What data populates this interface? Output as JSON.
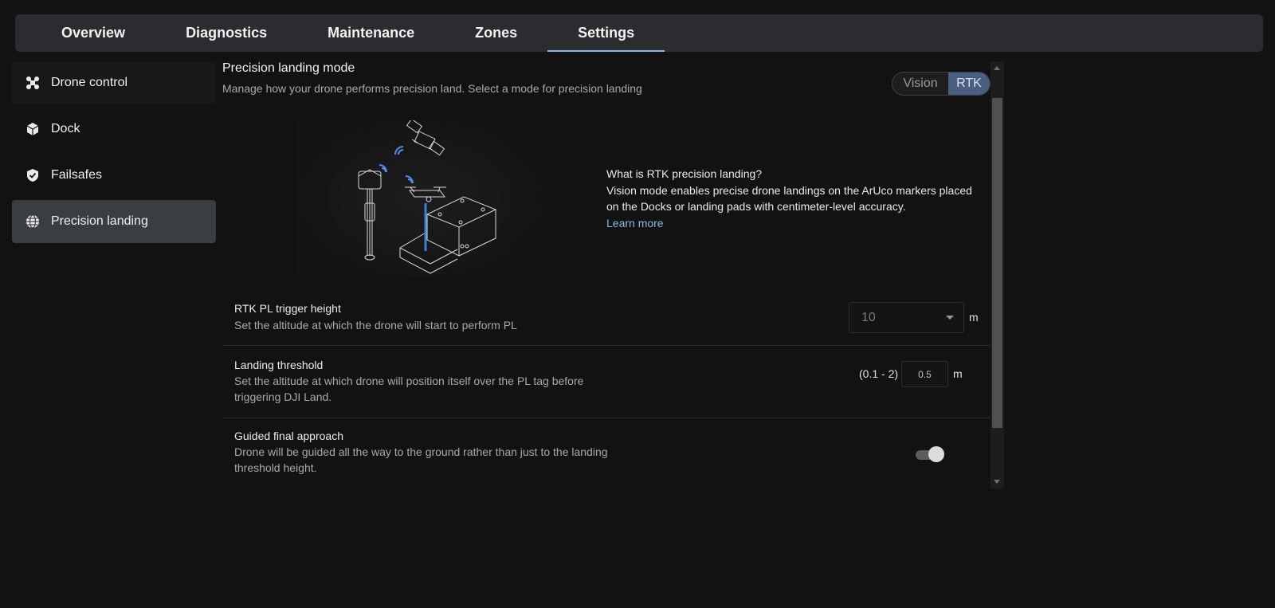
{
  "tabs": [
    {
      "label": "Overview"
    },
    {
      "label": "Diagnostics"
    },
    {
      "label": "Maintenance"
    },
    {
      "label": "Zones"
    },
    {
      "label": "Settings",
      "active": true
    }
  ],
  "sidebar": {
    "items": [
      {
        "label": "Drone control",
        "icon": "drone-icon"
      },
      {
        "label": "Dock",
        "icon": "cube-icon"
      },
      {
        "label": "Failsafes",
        "icon": "shield-check-icon"
      },
      {
        "label": "Precision landing",
        "icon": "globe-icon",
        "active": true
      }
    ]
  },
  "panel": {
    "title": "Precision landing mode",
    "description": "Manage how your drone performs precision land. Select a mode for precision landing",
    "mode_options": [
      "Vision",
      "RTK"
    ],
    "mode_selected": "RTK"
  },
  "info": {
    "heading": "What is RTK precision landing?",
    "body": "Vision mode enables precise drone landings on the ArUco markers placed on the Docks or landing pads with centimeter-level accuracy.",
    "link": "Learn more"
  },
  "settings": {
    "trigger_height": {
      "title": "RTK PL trigger height",
      "description": "Set the altitude at which the drone will start to perform PL",
      "value": "10",
      "unit": "m"
    },
    "landing_threshold": {
      "title": "Landing threshold",
      "description": "Set the altitude at which drone will position itself over the PL tag before triggering DJI Land.",
      "range": "(0.1 - 2)",
      "value": "0.5",
      "unit": "m"
    },
    "guided_approach": {
      "title": "Guided final approach",
      "description": "Drone will be guided all the way to the ground rather than just to the landing threshold height.",
      "enabled": true
    }
  },
  "colors": {
    "accent": "#8fb4e8",
    "selected_segment": "#4a5f80",
    "background": "#121212"
  }
}
